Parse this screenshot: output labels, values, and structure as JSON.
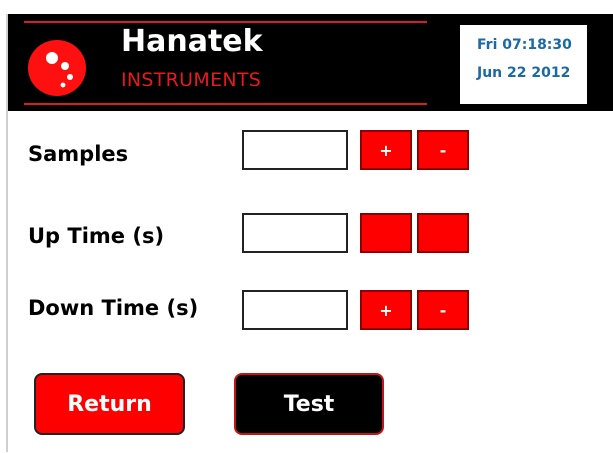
{
  "header": {
    "brand_name": "Hanatek",
    "brand_sub": "INSTRUMENTS",
    "clock_time": "Fri 07:18:30",
    "clock_date": "Jun 22 2012"
  },
  "rows": [
    {
      "label": "Samples",
      "value": "",
      "plus": "+",
      "minus": "-"
    },
    {
      "label": "Up Time (s)",
      "value": "",
      "plus": "",
      "minus": ""
    },
    {
      "label": "Down Time (s)",
      "value": "",
      "plus": "+",
      "minus": "-"
    }
  ],
  "buttons": {
    "return_label": "Return",
    "test_label": "Test"
  },
  "colors": {
    "accent_red": "#ff0000",
    "header_bg": "#000000",
    "clock_text": "#1a6aa6"
  },
  "icons": {
    "logo": "hanatek-logo-icon"
  }
}
